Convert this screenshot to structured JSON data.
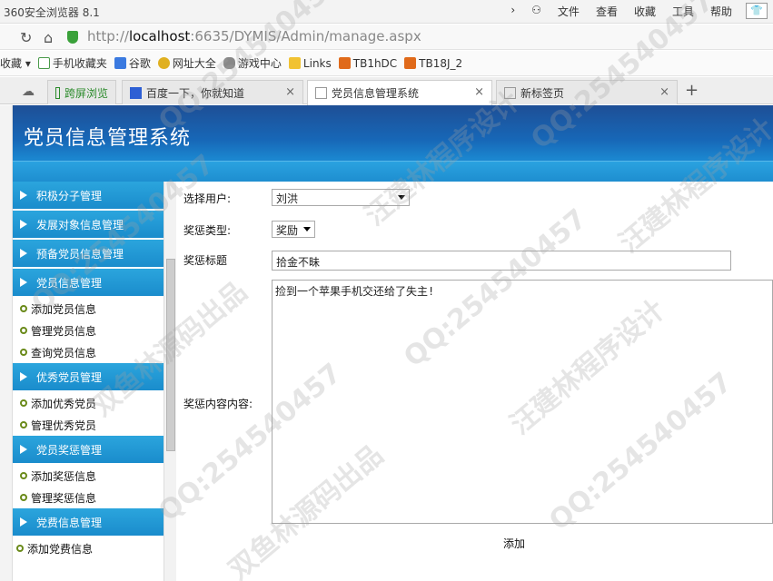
{
  "browser": {
    "app_title": "360安全浏览器 8.1",
    "menu": [
      "文件",
      "查看",
      "收藏",
      "工具",
      "帮助"
    ],
    "url_prefix": "http://",
    "url_host": "localhost",
    "url_rest": ":6635/DYMIS/Admin/manage.aspx",
    "bookmarks": [
      "收藏",
      "手机收藏夹",
      "谷歌",
      "网址大全",
      "游戏中心",
      "Links",
      "TB1hDC",
      "TB18J_2"
    ],
    "tabs": [
      {
        "label": "跨屏浏览"
      },
      {
        "label": "百度一下，你就知道"
      },
      {
        "label": "党员信息管理系统"
      },
      {
        "label": "新标签页"
      }
    ],
    "new_tab": "+"
  },
  "site": {
    "title": "党员信息管理系统"
  },
  "sidebar": {
    "groups": [
      {
        "title": "积极分子管理",
        "items": []
      },
      {
        "title": "发展对象信息管理",
        "items": []
      },
      {
        "title": "预备党员信息管理",
        "items": []
      },
      {
        "title": "党员信息管理",
        "items": [
          "添加党员信息",
          "管理党员信息",
          "查询党员信息"
        ]
      },
      {
        "title": "优秀党员管理",
        "items": [
          "添加优秀党员",
          "管理优秀党员"
        ]
      },
      {
        "title": "党员奖惩管理",
        "items": [
          "添加奖惩信息",
          "管理奖惩信息"
        ]
      },
      {
        "title": "党费信息管理",
        "items": [
          "添加党费信息"
        ]
      }
    ]
  },
  "form": {
    "user_label": "选择用户:",
    "user_value": "刘洪",
    "type_label": "奖惩类型:",
    "type_value": "奖励",
    "title_label": "奖惩标题",
    "title_value": "拾金不昧",
    "content_label": "奖惩内容内容:",
    "content_value": "捡到一个苹果手机交还给了失主!",
    "submit_label": "添加"
  },
  "watermarks": [
    "QQ:254540457",
    "汪建林程序设计",
    "双鱼林源码出品"
  ]
}
